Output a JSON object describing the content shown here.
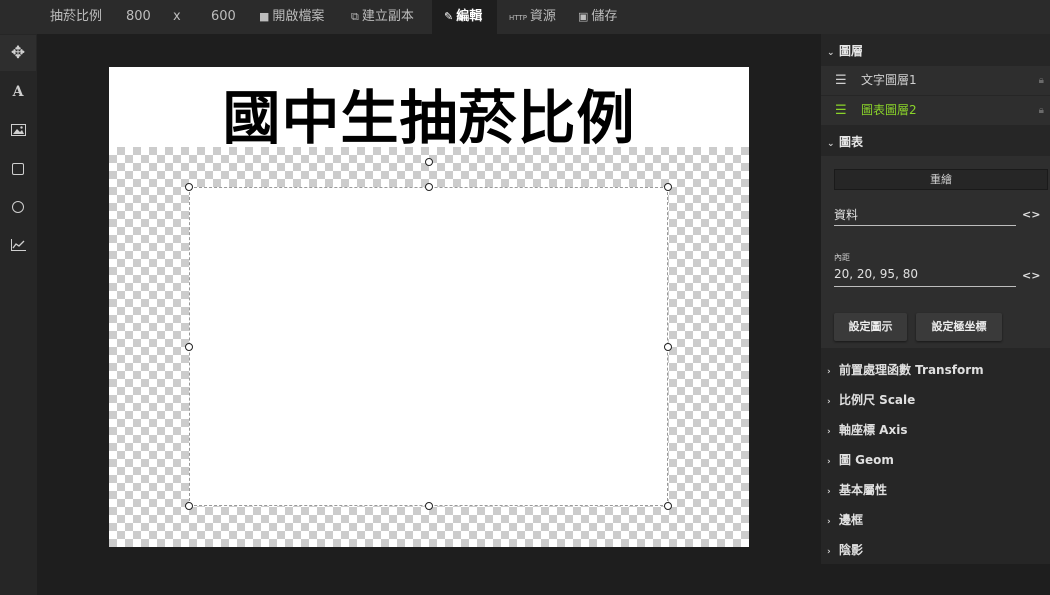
{
  "topbar": {
    "title": "抽菸比例",
    "width": "800",
    "times": "x",
    "height": "600",
    "open_label": "開啟檔案",
    "copy_label": "建立副本",
    "edit_label": "編輯",
    "resource_label": "資源",
    "save_label": "儲存"
  },
  "icons": {
    "move": "move-icon",
    "text": "text-tool-icon",
    "image": "image-tool-icon",
    "rect": "rect-tool-icon",
    "circle": "circle-tool-icon",
    "chart": "chart-tool-icon"
  },
  "canvas": {
    "title": "國中生抽菸比例"
  },
  "panel": {
    "layers_header": "圖層",
    "layers": [
      {
        "label": "文字圖層1",
        "active": false
      },
      {
        "label": "圖表圖層2",
        "active": true
      }
    ],
    "chart_header": "圖表",
    "redraw_label": "重繪",
    "data_label": "資料",
    "padding_label": "內距",
    "padding_value": "20, 20, 95, 80",
    "legend_button": "設定圖示",
    "polar_button": "設定極坐標",
    "sections": [
      "前置處理函數 Transform",
      "比例尺 Scale",
      "軸座標 Axis",
      "圖 Geom",
      "基本屬性",
      "邊框",
      "陰影"
    ]
  },
  "colors": {
    "accent": "#8bd42a",
    "background": "#1e1e1e",
    "panel": "#262626"
  }
}
